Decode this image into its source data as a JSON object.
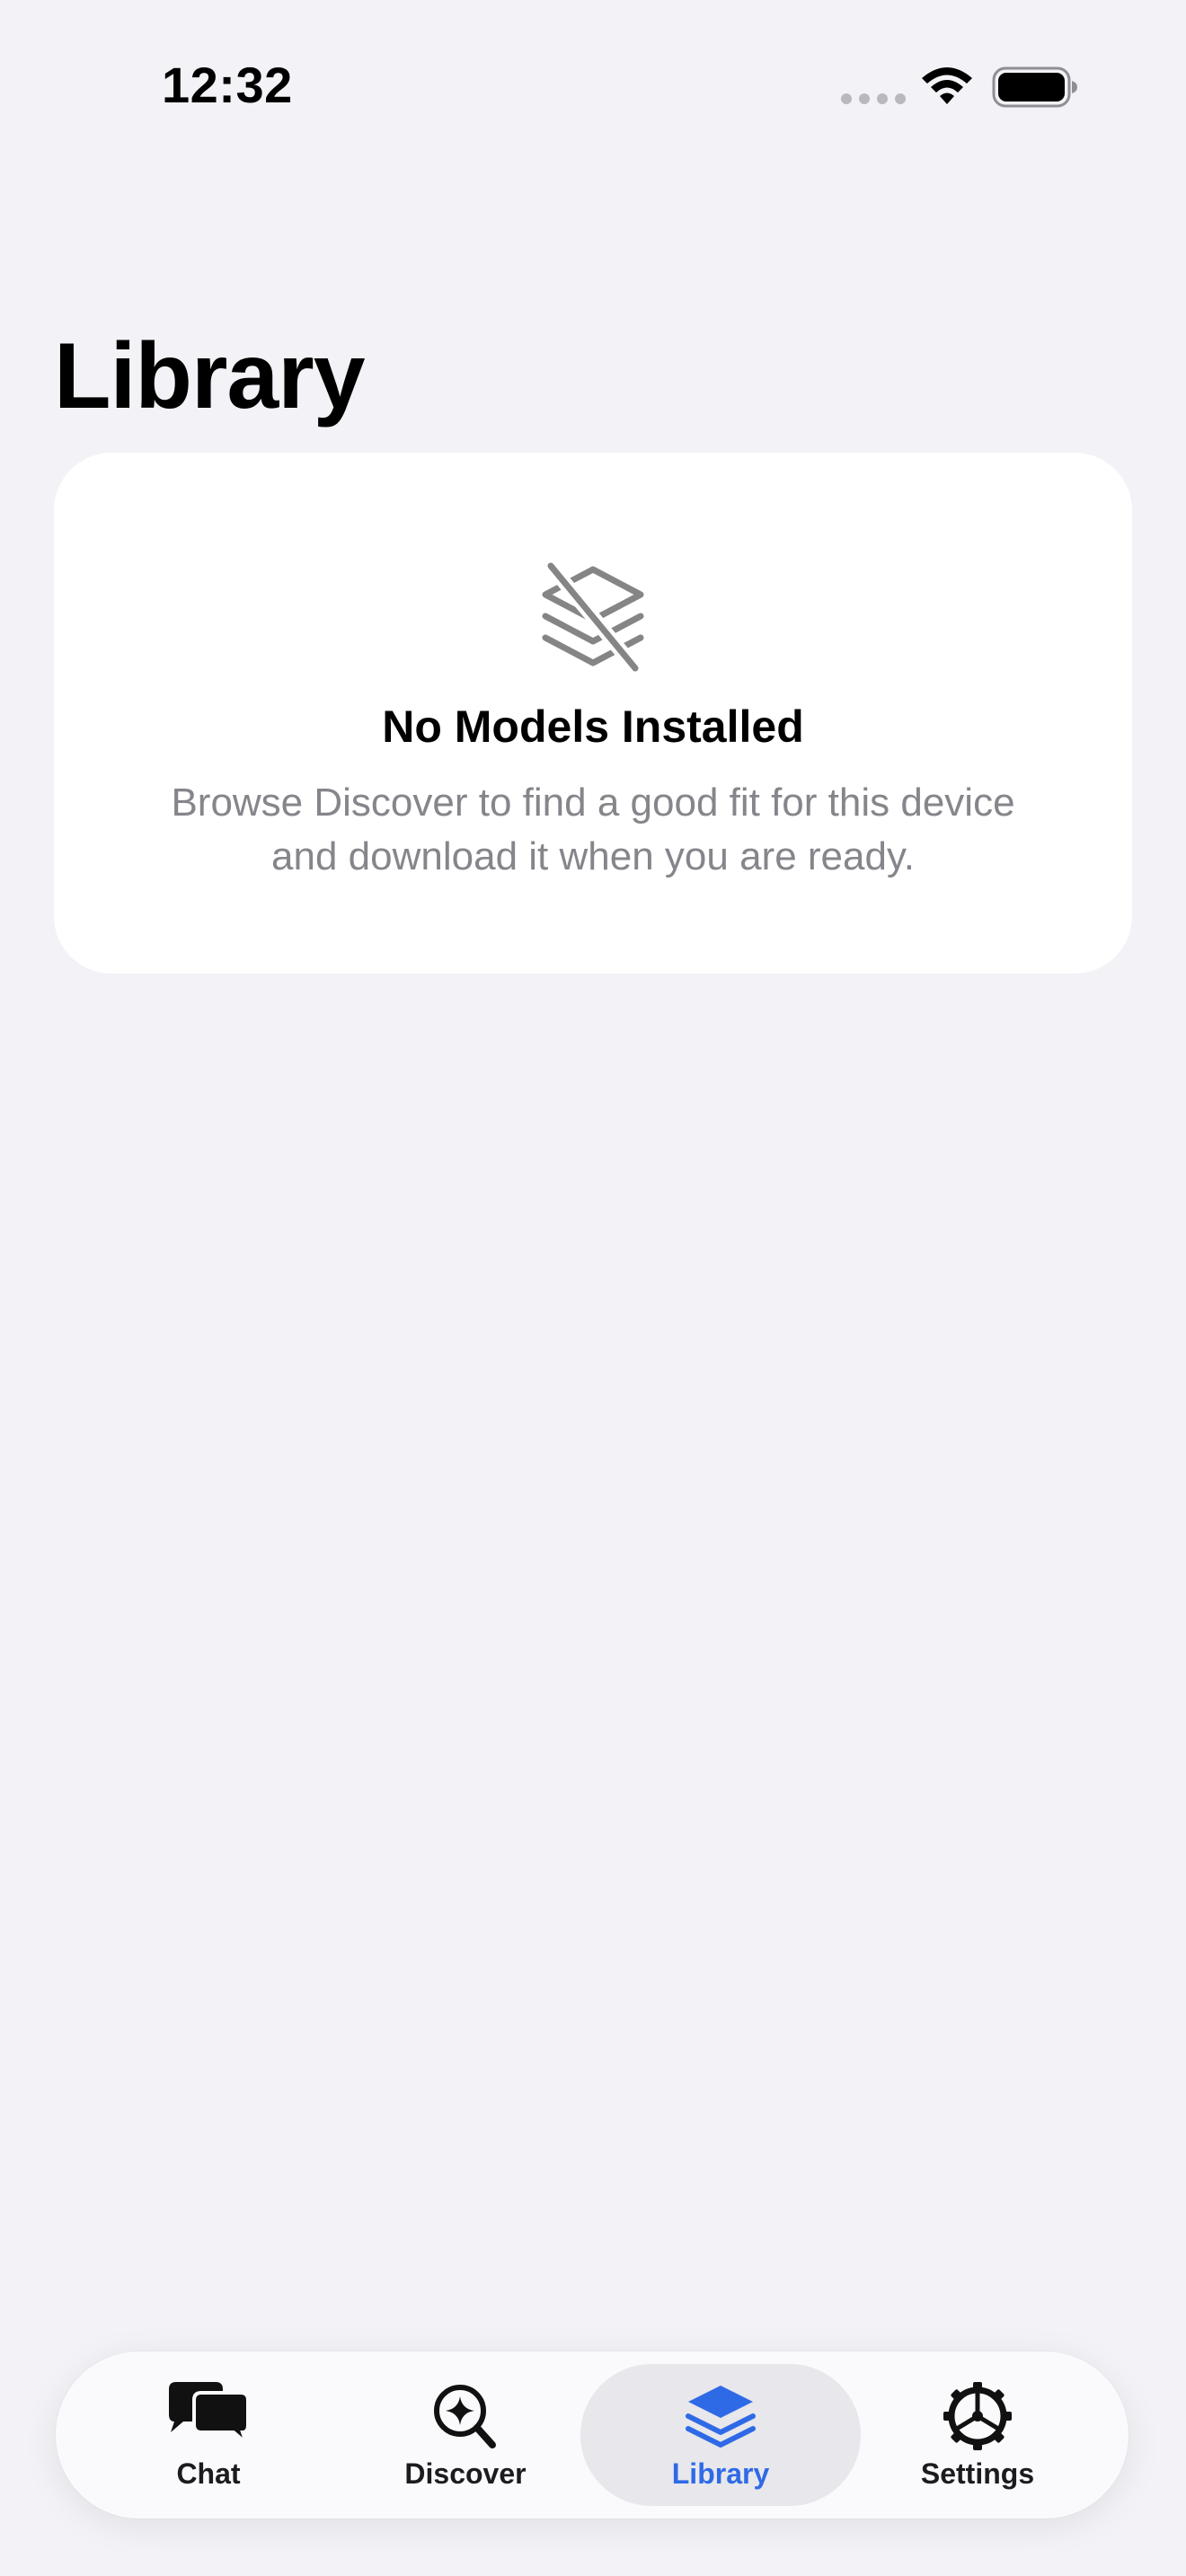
{
  "status_bar": {
    "time": "12:32"
  },
  "page": {
    "title": "Library"
  },
  "empty_state": {
    "icon": "layers-slash-icon",
    "title": "No Models Installed",
    "line1": "Browse Discover to find a good fit for this device",
    "line2": "and download it when you are ready."
  },
  "tab_bar": {
    "active_tab": "Library",
    "active_color": "#2f6ae6",
    "tabs": [
      {
        "label": "Chat",
        "icon": "chat-bubbles-icon"
      },
      {
        "label": "Discover",
        "icon": "discover-sparkle-magnifier-icon"
      },
      {
        "label": "Library",
        "icon": "layers-icon"
      },
      {
        "label": "Settings",
        "icon": "gear-icon"
      }
    ]
  }
}
